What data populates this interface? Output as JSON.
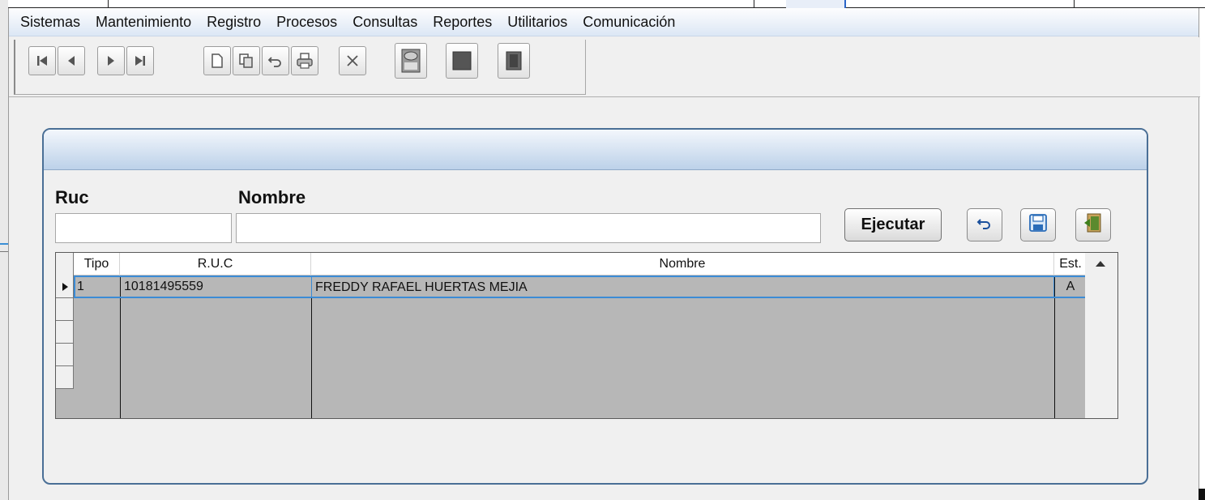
{
  "menu": [
    "Sistemas",
    "Mantenimiento",
    "Registro",
    "Procesos",
    "Consultas",
    "Reportes",
    "Utilitarios",
    "Comunicación"
  ],
  "toolbar": {
    "buttons": [
      {
        "icon": "first-record-icon"
      },
      {
        "icon": "previous-record-icon"
      },
      {
        "icon": "next-record-icon"
      },
      {
        "icon": "last-record-icon"
      },
      {
        "icon": "new-document-icon"
      },
      {
        "icon": "copy-icon"
      },
      {
        "icon": "undo-icon"
      },
      {
        "icon": "print-icon"
      },
      {
        "icon": "delete-icon"
      },
      {
        "icon": "calculator-icon"
      },
      {
        "icon": "stop-icon"
      },
      {
        "icon": "exit-door-icon"
      }
    ]
  },
  "form": {
    "ruc_label": "Ruc",
    "nombre_label": "Nombre",
    "ruc_value": "",
    "nombre_value": "",
    "execute_label": "Ejecutar"
  },
  "grid": {
    "columns": [
      "Tipo",
      "R.U.C",
      "Nombre",
      "Est."
    ],
    "rows": [
      {
        "tipo": "1",
        "ruc": "10181495559",
        "nombre": "FREDDY RAFAEL HUERTAS MEJIA",
        "est": "A"
      }
    ]
  },
  "colors": {
    "panel_border": "#4a6f96",
    "selection_border": "#3b8bd5",
    "grid_background": "#b7b7b7"
  }
}
